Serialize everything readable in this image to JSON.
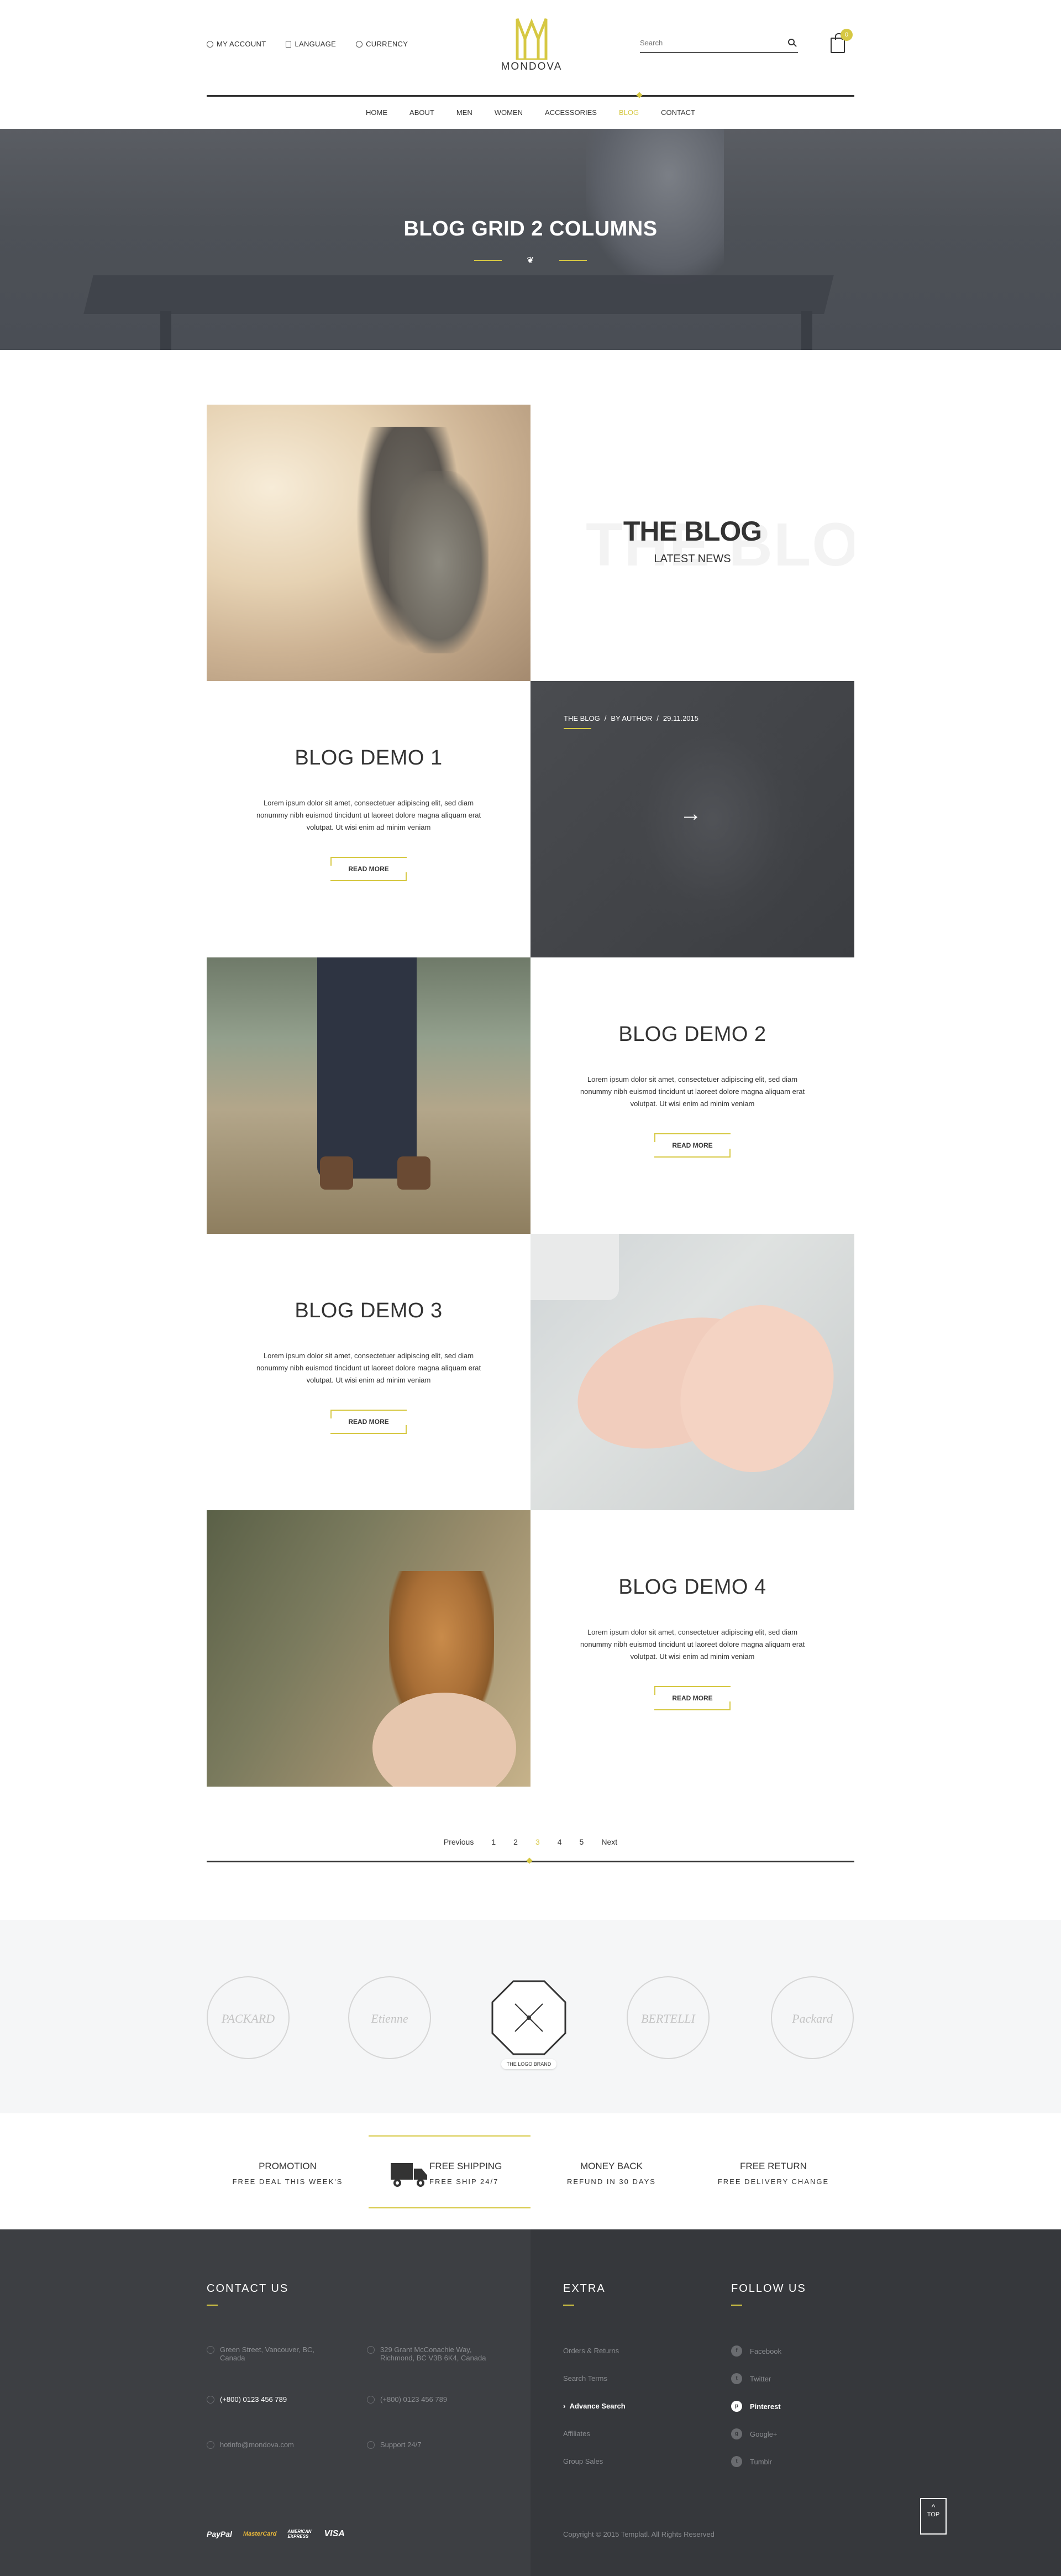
{
  "header": {
    "account": "MY ACCOUNT",
    "language": "LANGUAGE",
    "currency": "CURRENCY",
    "logo": "MONDOVA",
    "search_placeholder": "Search",
    "cart_count": "0"
  },
  "nav": [
    "HOME",
    "ABOUT",
    "MEN",
    "WOMEN",
    "ACCESSORIES",
    "BLOG",
    "CONTACT"
  ],
  "nav_active": "BLOG",
  "banner": {
    "title": "BLOG GRID 2 COLUMNS"
  },
  "intro": {
    "ghost": "THE BLOG",
    "title": "THE BLOG",
    "subtitle": "LATEST NEWS"
  },
  "featured_meta": {
    "category": "THE BLOG",
    "author": "BY AUTHOR",
    "date": "29.11.2015",
    "sep": "/"
  },
  "posts": [
    {
      "title": "BLOG DEMO 1",
      "excerpt": "Lorem ipsum dolor sit amet, consectetuer adipiscing elit, sed diam nonummy nibh euismod tincidunt ut laoreet dolore magna aliquam erat volutpat. Ut wisi enim ad minim veniam",
      "button": "READ MORE"
    },
    {
      "title": "BLOG DEMO 2",
      "excerpt": "Lorem ipsum dolor sit amet, consectetuer adipiscing elit, sed diam nonummy nibh euismod tincidunt ut laoreet dolore magna aliquam erat volutpat. Ut wisi enim ad minim veniam",
      "button": "READ MORE"
    },
    {
      "title": "BLOG DEMO 3",
      "excerpt": "Lorem ipsum dolor sit amet, consectetuer adipiscing elit, sed diam nonummy nibh euismod tincidunt ut laoreet dolore magna aliquam erat volutpat. Ut wisi enim ad minim veniam",
      "button": "READ MORE"
    },
    {
      "title": "BLOG DEMO 4",
      "excerpt": "Lorem ipsum dolor sit amet, consectetuer adipiscing elit, sed diam nonummy nibh euismod tincidunt ut laoreet dolore magna aliquam erat volutpat. Ut wisi enim ad minim veniam",
      "button": "READ MORE"
    }
  ],
  "pagination": {
    "prev": "Previous",
    "pages": [
      "1",
      "2",
      "3",
      "4",
      "5"
    ],
    "active": "3",
    "next": "Next"
  },
  "brands": [
    "PACKARD",
    "Etienne",
    "THE LOGO BRAND",
    "BERTELLI",
    "Packard"
  ],
  "brand_active_caption": "THE LOGO BRAND",
  "features": [
    {
      "title": "PROMOTION",
      "subtitle": "FREE DEAL THIS WEEK'S"
    },
    {
      "title": "FREE SHIPPING",
      "subtitle": "FREE SHIP 24/7"
    },
    {
      "title": "MONEY BACK",
      "subtitle": "REFUND IN 30 DAYS"
    },
    {
      "title": "FREE RETURN",
      "subtitle": "FREE DELIVERY CHANGE"
    }
  ],
  "footer": {
    "contact_title": "CONTACT US",
    "contact": {
      "address1": "Green Street, Vancouver, BC, Canada",
      "address2": "329 Grant McConachie Way, Richmond, BC V3B 6K4, Canada",
      "phone1": "(+800) 0123 456 789",
      "phone2": "(+800) 0123 456 789",
      "email": "hotinfo@mondova.com",
      "support": "Support 24/7"
    },
    "extra_title": "EXTRA",
    "extra_links": [
      "Orders & Returns",
      "Search Terms",
      "Advance Search",
      "Affiliates",
      "Group Sales"
    ],
    "extra_active": "Advance Search",
    "follow_title": "FOLLOW US",
    "follow_links": [
      "Facebook",
      "Twitter",
      "Pinterest",
      "Google+",
      "Tumblr"
    ],
    "follow_active": "Pinterest",
    "payments": [
      "PayPal",
      "MasterCard",
      "AMERICAN EXPRESS",
      "VISA"
    ],
    "copyright": "Copyright © 2015 Templatl. All Rights Reserved",
    "top": "TOP"
  },
  "colors": {
    "accent": "#d6c843",
    "dark": "#3d3f43",
    "text": "#333333"
  }
}
